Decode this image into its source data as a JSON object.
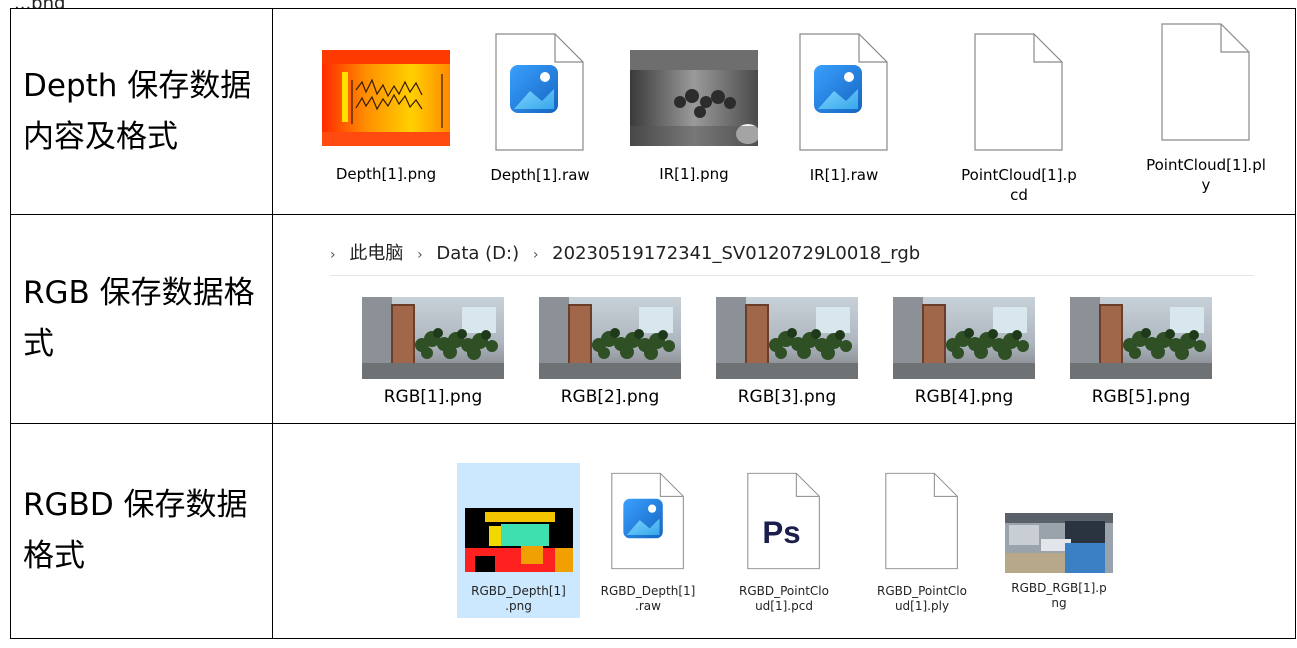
{
  "header": {
    "text": "...png"
  },
  "rows": [
    {
      "label": "Depth 保存数据内容及格式",
      "files": [
        {
          "name": "Depth[1].png",
          "icon": "depth-colormap-thumbnail"
        },
        {
          "name": "Depth[1].raw",
          "icon": "image-file-icon"
        },
        {
          "name": "IR[1].png",
          "icon": "ir-grayscale-thumbnail"
        },
        {
          "name": "IR[1].raw",
          "icon": "image-file-icon"
        },
        {
          "name": "PointCloud[1].p\ncd",
          "icon": "blank-file-icon"
        },
        {
          "name": "PointCloud[1].pl\ny",
          "icon": "blank-file-icon"
        }
      ]
    },
    {
      "label": "RGB 保存数据格式",
      "breadcrumb": [
        "此电脑",
        "Data (D:)",
        "20230519172341_SV0120729L0018_rgb"
      ],
      "files": [
        {
          "name": "RGB[1].png",
          "icon": "rgb-photo-thumbnail"
        },
        {
          "name": "RGB[2].png",
          "icon": "rgb-photo-thumbnail"
        },
        {
          "name": "RGB[3].png",
          "icon": "rgb-photo-thumbnail"
        },
        {
          "name": "RGB[4].png",
          "icon": "rgb-photo-thumbnail"
        },
        {
          "name": "RGB[5].png",
          "icon": "rgb-photo-thumbnail"
        }
      ]
    },
    {
      "label": "RGBD 保存数据格式",
      "files": [
        {
          "name": "RGBD_Depth[1]\n.png",
          "icon": "rgbd-depth-thumbnail",
          "selected": true
        },
        {
          "name": "RGBD_Depth[1]\n.raw",
          "icon": "image-file-icon"
        },
        {
          "name": "RGBD_PointClo\nud[1].pcd",
          "icon": "photoshop-file-icon",
          "icon_text": "Ps"
        },
        {
          "name": "RGBD_PointClo\nud[1].ply",
          "icon": "blank-file-icon"
        },
        {
          "name": "RGBD_RGB[1].p\nng",
          "icon": "rgbd-rgb-thumbnail"
        }
      ]
    }
  ],
  "colors": {
    "selection": "#cce8ff",
    "photos_blue": "#1e88e5",
    "ps_navy": "#1b1e4a"
  }
}
